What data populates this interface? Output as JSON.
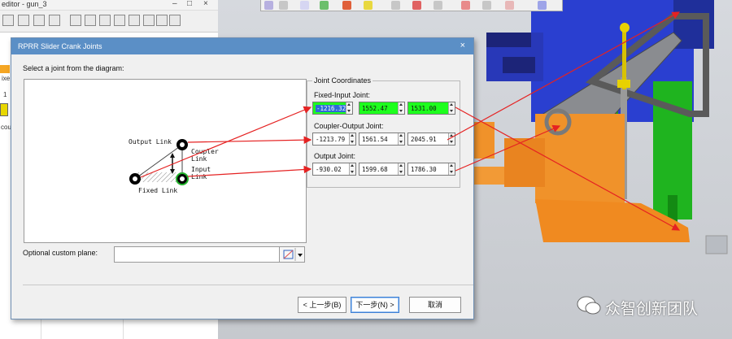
{
  "background_window": {
    "title": "editor - gun_3",
    "snippets": {
      "side_a": "1",
      "side_b": "ixe",
      "side_c": "coup"
    }
  },
  "dialog": {
    "title": "RPRR Slider Crank Joints",
    "close_glyph": "×",
    "prompt": "Select a joint from the diagram:",
    "diagram_labels": {
      "output_link": "Output Link",
      "coupler_link_line1": "Coupler",
      "coupler_link_line2": "Link",
      "input_link_line1": "Input",
      "input_link_line2": "Link",
      "fixed_link": "Fixed Link"
    },
    "joint_coordinates": {
      "group_title": "Joint Coordinates",
      "fixed_input": {
        "label": "Fixed-Input Joint:",
        "x": "-1216.32",
        "y": "1552.47",
        "z": "1531.00"
      },
      "coupler_output": {
        "label": "Coupler-Output Joint:",
        "x": "-1213.79",
        "y": "1561.54",
        "z": "2045.91"
      },
      "output": {
        "label": "Output Joint:",
        "x": "-930.02",
        "y": "1599.68",
        "z": "1786.30"
      }
    },
    "custom_plane": {
      "label": "Optional custom plane:",
      "value": ""
    },
    "buttons": {
      "back": "< 上一步(B)",
      "next": "下一步(N) >",
      "cancel": "取消"
    }
  },
  "watermark": {
    "text": "众智创新团队"
  },
  "colors": {
    "title_bar": "#5b8fc6",
    "highlight_field": "#1dff1d",
    "arrow": "#e52222",
    "part_orange": "#f0922a",
    "part_blue": "#2a3fd0",
    "part_green": "#1fb41f"
  }
}
